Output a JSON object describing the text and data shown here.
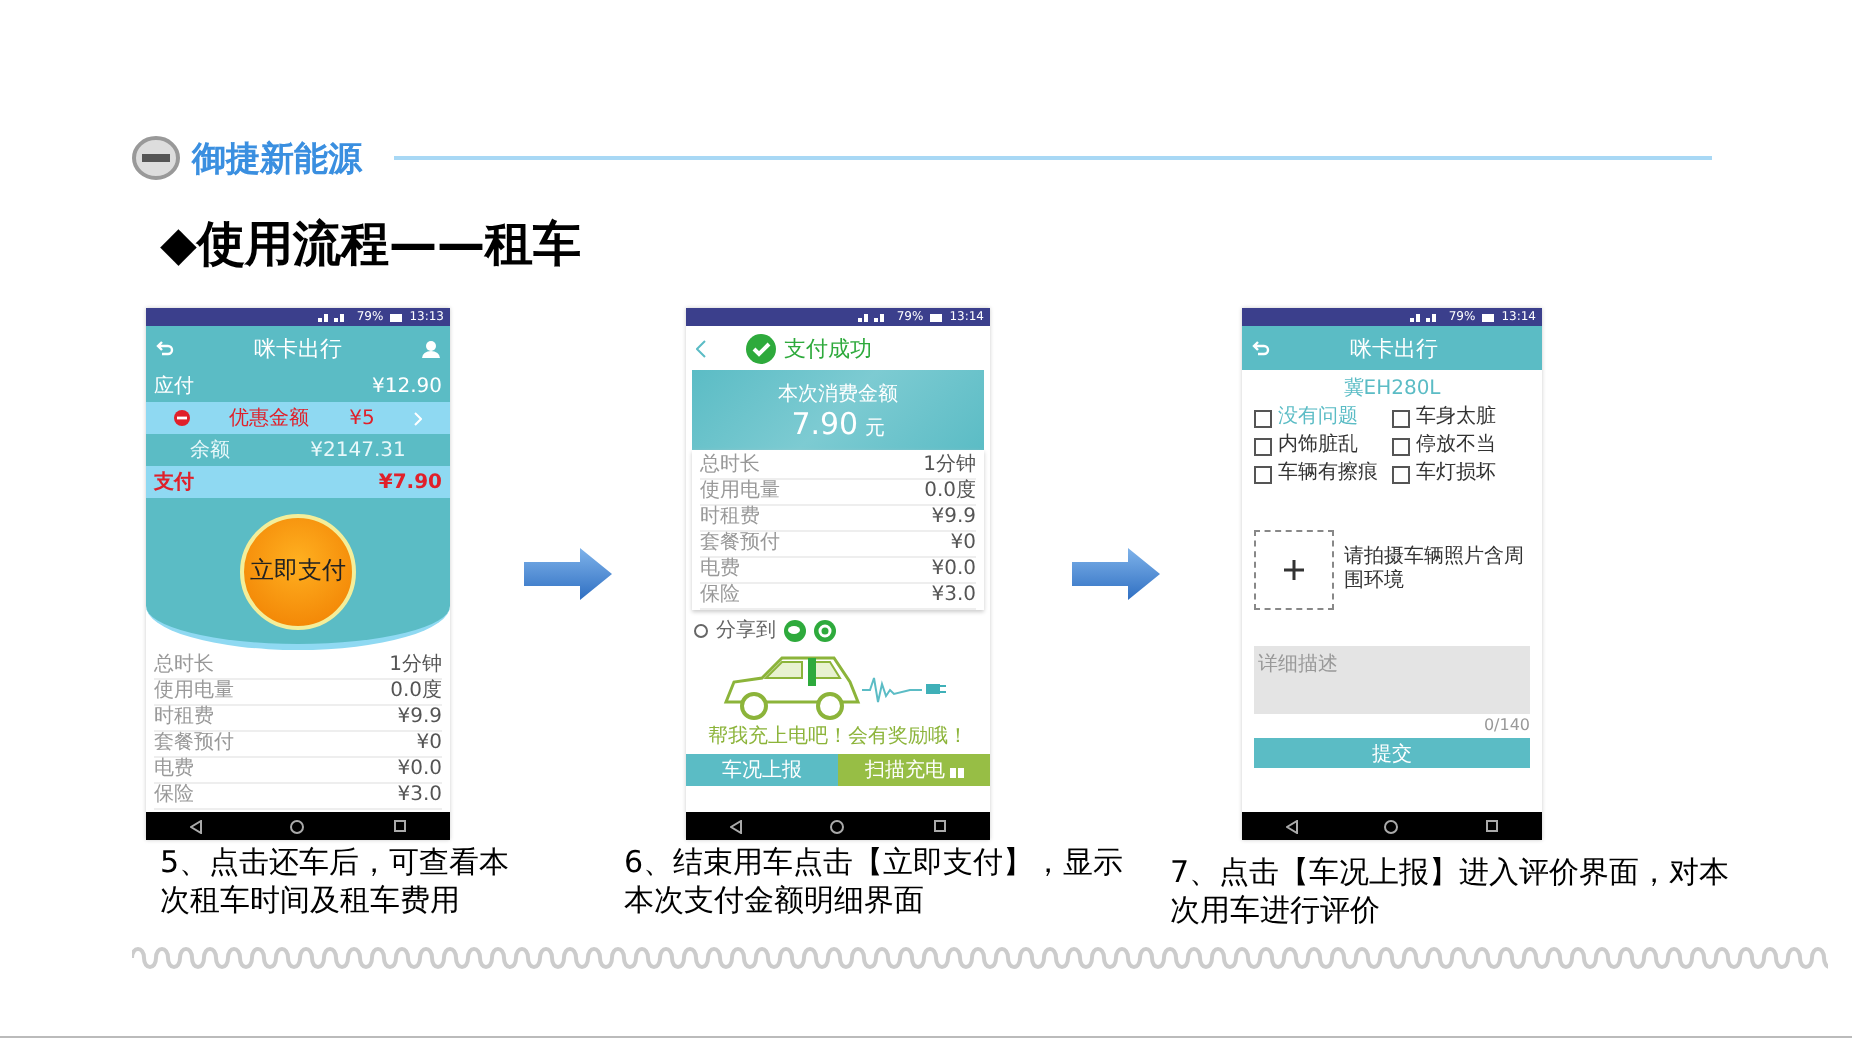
{
  "header": {
    "brand": "御捷新能源"
  },
  "title": "◆使用流程——租车",
  "phone_payment": {
    "status": {
      "time": "13:13",
      "battery": "79%"
    },
    "app_title": "咪卡出行",
    "summary_rows": [
      {
        "kind": "plain",
        "label": "应付",
        "value": "¥12.90"
      },
      {
        "kind": "discount",
        "label": "优惠金额",
        "value": "¥5"
      },
      {
        "kind": "centered",
        "label": "余额",
        "value": "¥2147.31"
      },
      {
        "kind": "total",
        "label": "支付",
        "value": "¥7.90"
      }
    ],
    "pay_button": "立即支付",
    "detail_rows": [
      {
        "label": "总时长",
        "value": "1分钟"
      },
      {
        "label": "使用电量",
        "value": "0.0度"
      },
      {
        "label": "时租费",
        "value": "¥9.9"
      },
      {
        "label": "套餐预付",
        "value": "¥0"
      },
      {
        "label": "电费",
        "value": "¥0.0"
      },
      {
        "label": "保险",
        "value": "¥3.0"
      }
    ]
  },
  "phone_success": {
    "status": {
      "time": "13:14",
      "battery": "79%"
    },
    "app_title": "支付成功",
    "amount_label": "本次消费金额",
    "amount": "7.90",
    "unit": "元",
    "detail_rows": [
      {
        "label": "总时长",
        "value": "1分钟"
      },
      {
        "label": "使用电量",
        "value": "0.0度"
      },
      {
        "label": "时租费",
        "value": "¥9.9"
      },
      {
        "label": "套餐预付",
        "value": "¥0"
      },
      {
        "label": "电费",
        "value": "¥0.0"
      },
      {
        "label": "保险",
        "value": "¥3.0"
      }
    ],
    "share_label": "分享到",
    "promo": "帮我充上电吧！会有奖励哦！",
    "buttons": [
      {
        "kind": "report",
        "label": "车况上报"
      },
      {
        "kind": "scan",
        "label": "扫描充电"
      }
    ]
  },
  "phone_report": {
    "status": {
      "time": "13:14",
      "battery": "79%"
    },
    "app_title": "咪卡出行",
    "plate": "冀EH280L",
    "options": [
      {
        "label": "没有问题",
        "checked": false,
        "highlighted": true
      },
      {
        "label": "车身太脏",
        "checked": false,
        "highlighted": false
      },
      {
        "label": "内饰脏乱",
        "checked": false,
        "highlighted": false
      },
      {
        "label": "停放不当",
        "checked": false,
        "highlighted": false
      },
      {
        "label": "车辆有擦痕",
        "checked": false,
        "highlighted": false
      },
      {
        "label": "车灯损坏",
        "checked": false,
        "highlighted": false
      }
    ],
    "photo_hint": "请拍摄车辆照片含周围环境",
    "description": {
      "placeholder": "详细描述"
    },
    "counter": "0/140",
    "submit": "提交"
  },
  "captions": [
    "5、点击还车后，可查看本次租车时间及租车费用",
    "6、结束用车点击【立即支付】，显示本次支付金额明细界面",
    "7、点击【车况上报】进入评价界面，对本次用车进行评价"
  ]
}
